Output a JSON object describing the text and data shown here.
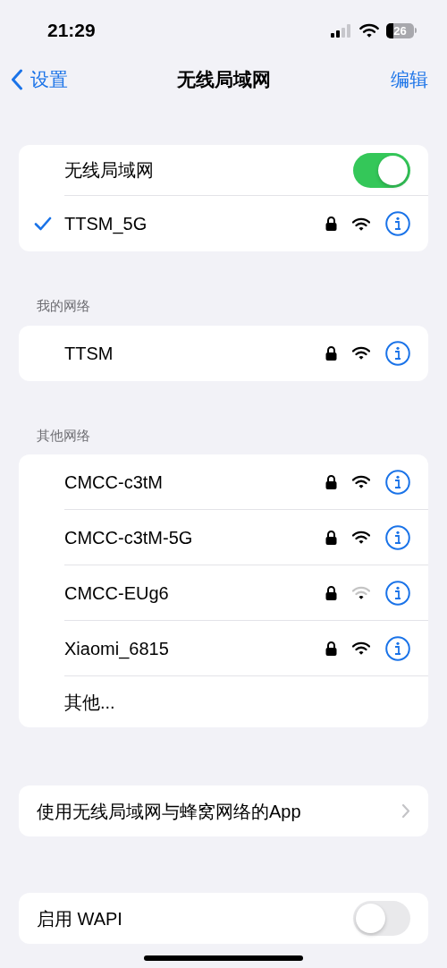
{
  "status_bar": {
    "time": "21:29",
    "battery": "26"
  },
  "nav": {
    "back": "设置",
    "title": "无线局域网",
    "action": "编辑"
  },
  "wifi": {
    "label": "无线局域网",
    "on": true,
    "connected": {
      "name": "TTSM_5G",
      "checked": true,
      "locked": true,
      "weak_signal": false
    }
  },
  "sections": [
    {
      "header": "我的网络",
      "networks": [
        {
          "name": "TTSM",
          "locked": true,
          "weak_signal": false
        }
      ]
    },
    {
      "header": "其他网络",
      "networks": [
        {
          "name": "CMCC-c3tM",
          "locked": true,
          "weak_signal": false
        },
        {
          "name": "CMCC-c3tM-5G",
          "locked": true,
          "weak_signal": false
        },
        {
          "name": "CMCC-EUg6",
          "locked": true,
          "weak_signal": true
        },
        {
          "name": "Xiaomi_6815",
          "locked": true,
          "weak_signal": false
        }
      ],
      "other": "其他..."
    }
  ],
  "apps_row": {
    "label": "使用无线局域网与蜂窝网络的App"
  },
  "wapi": {
    "label": "启用 WAPI",
    "on": false
  }
}
